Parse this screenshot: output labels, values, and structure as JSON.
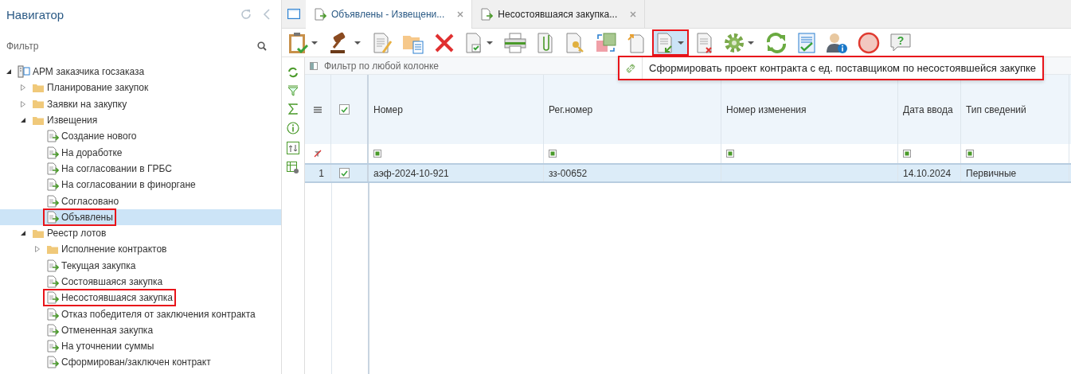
{
  "navigator": {
    "title": "Навигатор",
    "filter": {
      "placeholder": "Фильтр"
    },
    "tree": [
      {
        "label": "АРМ заказчика госзаказа",
        "kind": "root",
        "expanded": true,
        "selected": false,
        "highlighted": false,
        "children": [
          {
            "label": "Планирование закупок",
            "kind": "folder",
            "expanded": false,
            "selected": false,
            "highlighted": false
          },
          {
            "label": "Заявки на закупку",
            "kind": "folder",
            "expanded": false,
            "selected": false,
            "highlighted": false
          },
          {
            "label": "Извещения",
            "kind": "folder",
            "expanded": true,
            "selected": false,
            "highlighted": false,
            "children": [
              {
                "label": "Создание нового",
                "kind": "doc",
                "selected": false,
                "highlighted": false
              },
              {
                "label": "На доработке",
                "kind": "doc",
                "selected": false,
                "highlighted": false
              },
              {
                "label": "На согласовании в ГРБС",
                "kind": "doc",
                "selected": false,
                "highlighted": false
              },
              {
                "label": "На согласовании в финоргане",
                "kind": "doc",
                "selected": false,
                "highlighted": false
              },
              {
                "label": "Согласовано",
                "kind": "doc",
                "selected": false,
                "highlighted": false
              },
              {
                "label": "Объявлены",
                "kind": "doc",
                "selected": true,
                "highlighted": true
              }
            ]
          },
          {
            "label": "Реестр лотов",
            "kind": "folder",
            "expanded": true,
            "selected": false,
            "highlighted": false,
            "children": [
              {
                "label": "Исполнение контрактов",
                "kind": "folder",
                "expanded": false,
                "selected": false,
                "highlighted": false
              },
              {
                "label": "Текущая закупка",
                "kind": "doc",
                "selected": false,
                "highlighted": false
              },
              {
                "label": "Состоявшаяся закупка",
                "kind": "doc",
                "selected": false,
                "highlighted": false
              },
              {
                "label": "Несостоявшаяся закупка",
                "kind": "doc",
                "selected": false,
                "highlighted": true
              },
              {
                "label": "Отказ победителя от заключения контракта",
                "kind": "doc",
                "selected": false,
                "highlighted": false
              },
              {
                "label": "Отмененная закупка",
                "kind": "doc",
                "selected": false,
                "highlighted": false
              },
              {
                "label": "На уточнении суммы",
                "kind": "doc",
                "selected": false,
                "highlighted": false
              },
              {
                "label": "Сформирован/заключен контракт",
                "kind": "doc",
                "selected": false,
                "highlighted": false
              }
            ]
          }
        ]
      }
    ]
  },
  "tabs": [
    {
      "label": "Объявлены - Извещени...",
      "selected": true
    },
    {
      "label": "Несостоявшаяся закупка...",
      "selected": false
    }
  ],
  "toolbar": [
    {
      "kind": "clipboard",
      "dropdown": true,
      "active": false,
      "highlighted": false
    },
    {
      "kind": "gavel",
      "dropdown": true,
      "active": false,
      "highlighted": false
    },
    {
      "kind": "docpencil",
      "dropdown": false,
      "active": false,
      "highlighted": false
    },
    {
      "kind": "folderdoc",
      "dropdown": false,
      "active": false,
      "highlighted": false
    },
    {
      "kind": "delete",
      "dropdown": false,
      "active": false,
      "highlighted": false
    },
    {
      "kind": "doccheck",
      "dropdown": true,
      "active": false,
      "highlighted": false
    },
    {
      "kind": "printer",
      "dropdown": false,
      "active": false,
      "highlighted": false
    },
    {
      "kind": "clip",
      "dropdown": false,
      "active": false,
      "highlighted": false
    },
    {
      "kind": "dockey",
      "dropdown": false,
      "active": false,
      "highlighted": false
    },
    {
      "kind": "swap",
      "dropdown": false,
      "active": false,
      "highlighted": false
    },
    {
      "kind": "docup",
      "dropdown": false,
      "active": false,
      "highlighted": false
    },
    {
      "kind": "docdown",
      "dropdown": true,
      "active": true,
      "highlighted": true
    },
    {
      "kind": "docx",
      "dropdown": false,
      "active": false,
      "highlighted": false
    },
    {
      "kind": "gear",
      "dropdown": true,
      "active": false,
      "highlighted": false
    },
    {
      "kind": "refresh",
      "dropdown": false,
      "active": false,
      "highlighted": false
    },
    {
      "kind": "form",
      "dropdown": false,
      "active": false,
      "highlighted": false
    },
    {
      "kind": "userinfo",
      "dropdown": false,
      "active": false,
      "highlighted": false
    },
    {
      "kind": "circle",
      "dropdown": false,
      "active": false,
      "highlighted": false
    },
    {
      "kind": "help",
      "glyph": "?",
      "dropdown": false,
      "active": false,
      "highlighted": false
    }
  ],
  "menu": {
    "highlighted": true,
    "items": [
      {
        "label": "Сформировать проект контракта с ед. поставщиком по несостоявшейся закупке"
      }
    ]
  },
  "grid_filter": {
    "placeholder": "Фильтр по любой колонке"
  },
  "table": {
    "all_checked": true,
    "columns": [
      "Номер",
      "Рег.номер",
      "Номер изменения",
      "Дата ввода",
      "Тип сведений"
    ],
    "rows": [
      {
        "number": "1",
        "checked": true,
        "selected": true,
        "cells": [
          "аэф-2024-10-921",
          "зз-00652",
          null,
          "14.10.2024",
          "Первичные"
        ]
      }
    ]
  }
}
